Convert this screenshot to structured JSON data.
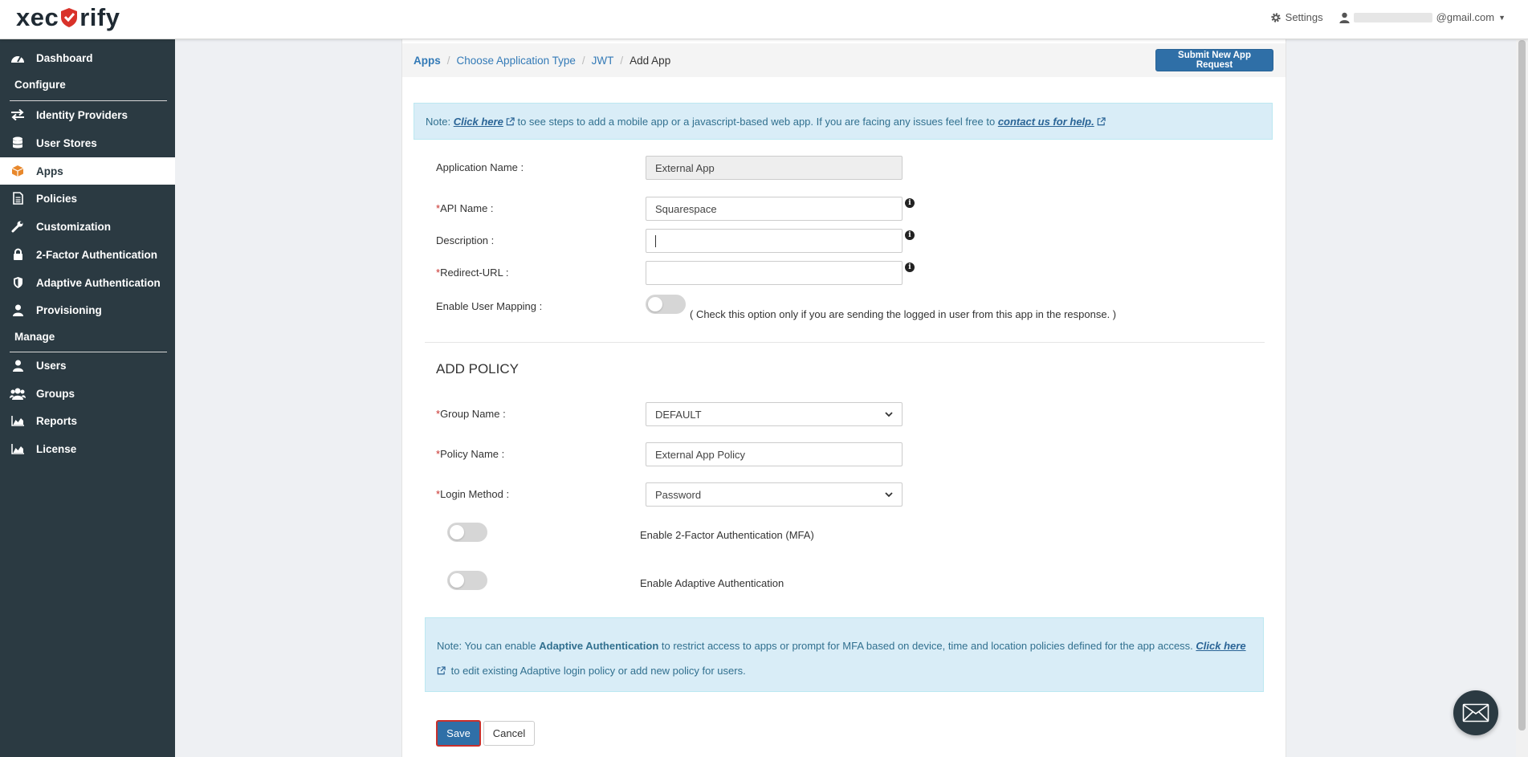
{
  "brand": {
    "logo_text_left": "xec",
    "logo_text_right": "rify"
  },
  "topbar": {
    "settings_label": "Settings",
    "user_email_suffix": "@gmail.com"
  },
  "sidebar": {
    "items": [
      {
        "label": "Dashboard",
        "icon": "dashboard-icon"
      },
      {
        "label": "Identity Providers",
        "icon": "exchange-icon"
      },
      {
        "label": "User Stores",
        "icon": "database-icon"
      },
      {
        "label": "Apps",
        "icon": "cube-icon",
        "active": true
      },
      {
        "label": "Policies",
        "icon": "document-icon"
      },
      {
        "label": "Customization",
        "icon": "wrench-icon"
      },
      {
        "label": "2-Factor Authentication",
        "icon": "lock-icon"
      },
      {
        "label": "Adaptive Authentication",
        "icon": "shield-icon"
      },
      {
        "label": "Provisioning",
        "icon": "user-icon"
      },
      {
        "label": "Users",
        "icon": "user-icon"
      },
      {
        "label": "Groups",
        "icon": "users-icon"
      },
      {
        "label": "Reports",
        "icon": "area-chart-icon"
      },
      {
        "label": "License",
        "icon": "area-chart-icon"
      }
    ],
    "section_configure": "Configure",
    "section_manage": "Manage"
  },
  "breadcrumb": {
    "apps": "Apps",
    "choose": "Choose Application Type",
    "jwt": "JWT",
    "current": "Add App",
    "sep": "/"
  },
  "submit_request_label": "Submit New App Request",
  "note_top": {
    "prefix": "Note: ",
    "click_here": "Click here",
    "middle": " to see steps to add a mobile app or a javascript-based web app. If you are facing any issues feel free to ",
    "contact": "contact us for help."
  },
  "form": {
    "app_name_label": "Application Name :",
    "app_name_value": "External App",
    "api_name_label": "API Name :",
    "api_name_value": "Squarespace",
    "description_label": "Description :",
    "description_value": "",
    "redirect_label": "Redirect-URL :",
    "redirect_value": "",
    "user_mapping_label": "Enable User Mapping :",
    "user_mapping_hint": "( Check this option only if you are sending the logged in user from this app in the response. )",
    "required_mark": "*"
  },
  "policy": {
    "title": "ADD POLICY",
    "group_label": "Group Name :",
    "group_value": "DEFAULT",
    "policy_label": "Policy Name :",
    "policy_value": "External App Policy",
    "login_label": "Login Method :",
    "login_value": "Password",
    "mfa_label": "Enable 2-Factor Authentication (MFA)",
    "adaptive_label": "Enable Adaptive Authentication"
  },
  "note_bottom": {
    "prefix": "Note: You can enable ",
    "bold": "Adaptive Authentication",
    "middle": " to restrict access to apps or prompt for MFA based on device, time and location policies defined for the app access. ",
    "click_here": "Click here",
    "suffix": " to edit existing Adaptive login policy or add new policy for users."
  },
  "actions": {
    "save": "Save",
    "cancel": "Cancel"
  },
  "colors": {
    "sidebar_bg": "#2b3a42",
    "primary": "#2f6fa7",
    "accent_orange": "#e8882c",
    "note_bg": "#d9edf7"
  }
}
